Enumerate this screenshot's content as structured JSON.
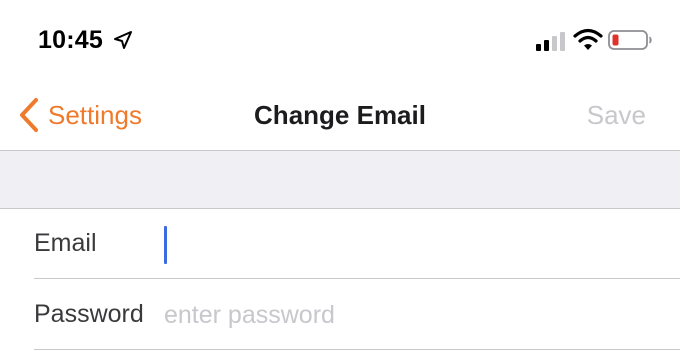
{
  "status_bar": {
    "time": "10:45",
    "location_icon": "location-arrow-icon",
    "signal_icon": "cellular-signal-icon",
    "wifi_icon": "wifi-icon",
    "battery_icon": "battery-low-icon",
    "battery_color": "#e0312b"
  },
  "nav": {
    "back_label": "Settings",
    "title": "Change Email",
    "save_label": "Save",
    "accent_color": "#f07a2c",
    "disabled_color": "#c7c7cc"
  },
  "form": {
    "email": {
      "label": "Email",
      "value": "",
      "placeholder": ""
    },
    "password": {
      "label": "Password",
      "value": "",
      "placeholder": "enter password"
    }
  }
}
